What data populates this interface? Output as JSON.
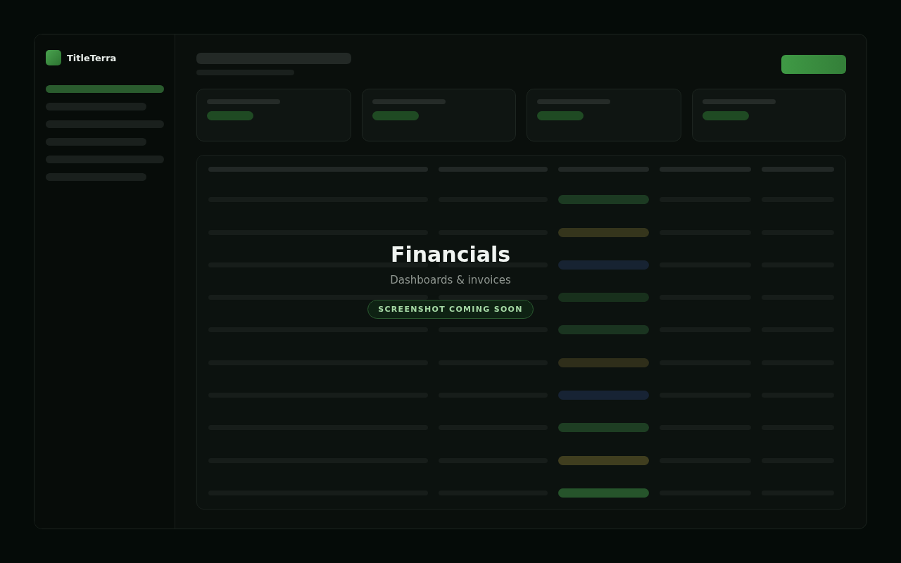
{
  "brand": {
    "name": "TitleTerra"
  },
  "sidebar": {
    "items": [
      {
        "selected": true
      },
      {
        "selected": false
      },
      {
        "selected": false
      },
      {
        "selected": false
      },
      {
        "selected": false
      },
      {
        "selected": false
      }
    ]
  },
  "table": {
    "rows": [
      {
        "color": "#1c3a22"
      },
      {
        "color": "#35351c"
      },
      {
        "color": "#172332"
      },
      {
        "color": "#18301c"
      },
      {
        "color": "#1a3420"
      },
      {
        "color": "#2f2e1a"
      },
      {
        "color": "#172334"
      },
      {
        "color": "#1e3e23"
      },
      {
        "color": "#403e1f"
      },
      {
        "color": "#26542b"
      }
    ]
  },
  "overlay": {
    "title": "Financials",
    "subtitle": "Dashboards & invoices",
    "badge": "SCREENSHOT COMING SOON"
  }
}
